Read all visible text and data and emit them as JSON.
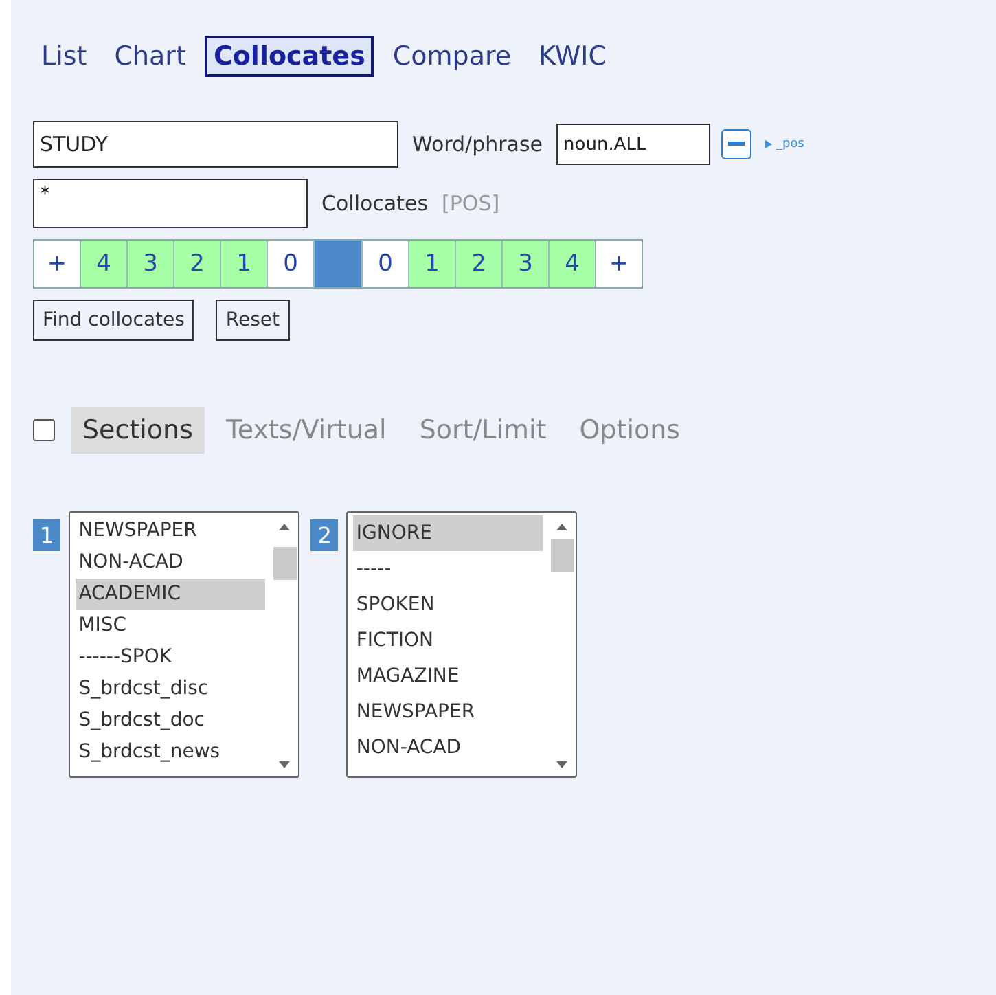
{
  "tabs": [
    {
      "label": "List",
      "selected": false
    },
    {
      "label": "Chart",
      "selected": false
    },
    {
      "label": "Collocates",
      "selected": true
    },
    {
      "label": "Compare",
      "selected": false
    },
    {
      "label": "KWIC",
      "selected": false
    }
  ],
  "word_field": {
    "value": "STUDY",
    "label": "Word/phrase"
  },
  "pos_field": {
    "value": "noun.ALL"
  },
  "pos_toggle": {
    "label": "_pos"
  },
  "collocates_field": {
    "value": "*",
    "label": "Collocates",
    "pos_link": "[POS]"
  },
  "span": [
    {
      "kind": "more",
      "label": "+",
      "selected": false
    },
    {
      "kind": "num",
      "label": "4",
      "selected": true
    },
    {
      "kind": "num",
      "label": "3",
      "selected": true
    },
    {
      "kind": "num",
      "label": "2",
      "selected": true
    },
    {
      "kind": "num",
      "label": "1",
      "selected": true
    },
    {
      "kind": "num",
      "label": "0",
      "selected": false
    },
    {
      "kind": "node"
    },
    {
      "kind": "num",
      "label": "0",
      "selected": false
    },
    {
      "kind": "num",
      "label": "1",
      "selected": true
    },
    {
      "kind": "num",
      "label": "2",
      "selected": true
    },
    {
      "kind": "num",
      "label": "3",
      "selected": true
    },
    {
      "kind": "num",
      "label": "4",
      "selected": true
    },
    {
      "kind": "more",
      "label": "+",
      "selected": false
    }
  ],
  "buttons": [
    "Find collocates",
    "Reset"
  ],
  "options": {
    "checked": false,
    "tabs": [
      {
        "label": "Sections",
        "selected": true
      },
      {
        "label": "Texts/Virtual",
        "selected": false
      },
      {
        "label": "Sort/Limit",
        "selected": false
      },
      {
        "label": "Options",
        "selected": false
      }
    ]
  },
  "section_lists": [
    {
      "number": "1",
      "items": [
        {
          "label": "NEWSPAPER",
          "selected": false
        },
        {
          "label": "NON-ACAD",
          "selected": false
        },
        {
          "label": "ACADEMIC",
          "selected": true
        },
        {
          "label": "MISC",
          "selected": false
        },
        {
          "label": "------SPOK",
          "selected": false
        },
        {
          "label": "S_brdcst_disc",
          "selected": false
        },
        {
          "label": "S_brdcst_doc",
          "selected": false
        },
        {
          "label": "S_brdcst_news",
          "selected": false
        }
      ]
    },
    {
      "number": "2",
      "items": [
        {
          "label": "IGNORE",
          "selected": true
        },
        {
          "label": "-----",
          "selected": false
        },
        {
          "label": "SPOKEN",
          "selected": false
        },
        {
          "label": "FICTION",
          "selected": false
        },
        {
          "label": "MAGAZINE",
          "selected": false
        },
        {
          "label": "NEWSPAPER",
          "selected": false
        },
        {
          "label": "NON-ACAD",
          "selected": false
        }
      ]
    }
  ]
}
